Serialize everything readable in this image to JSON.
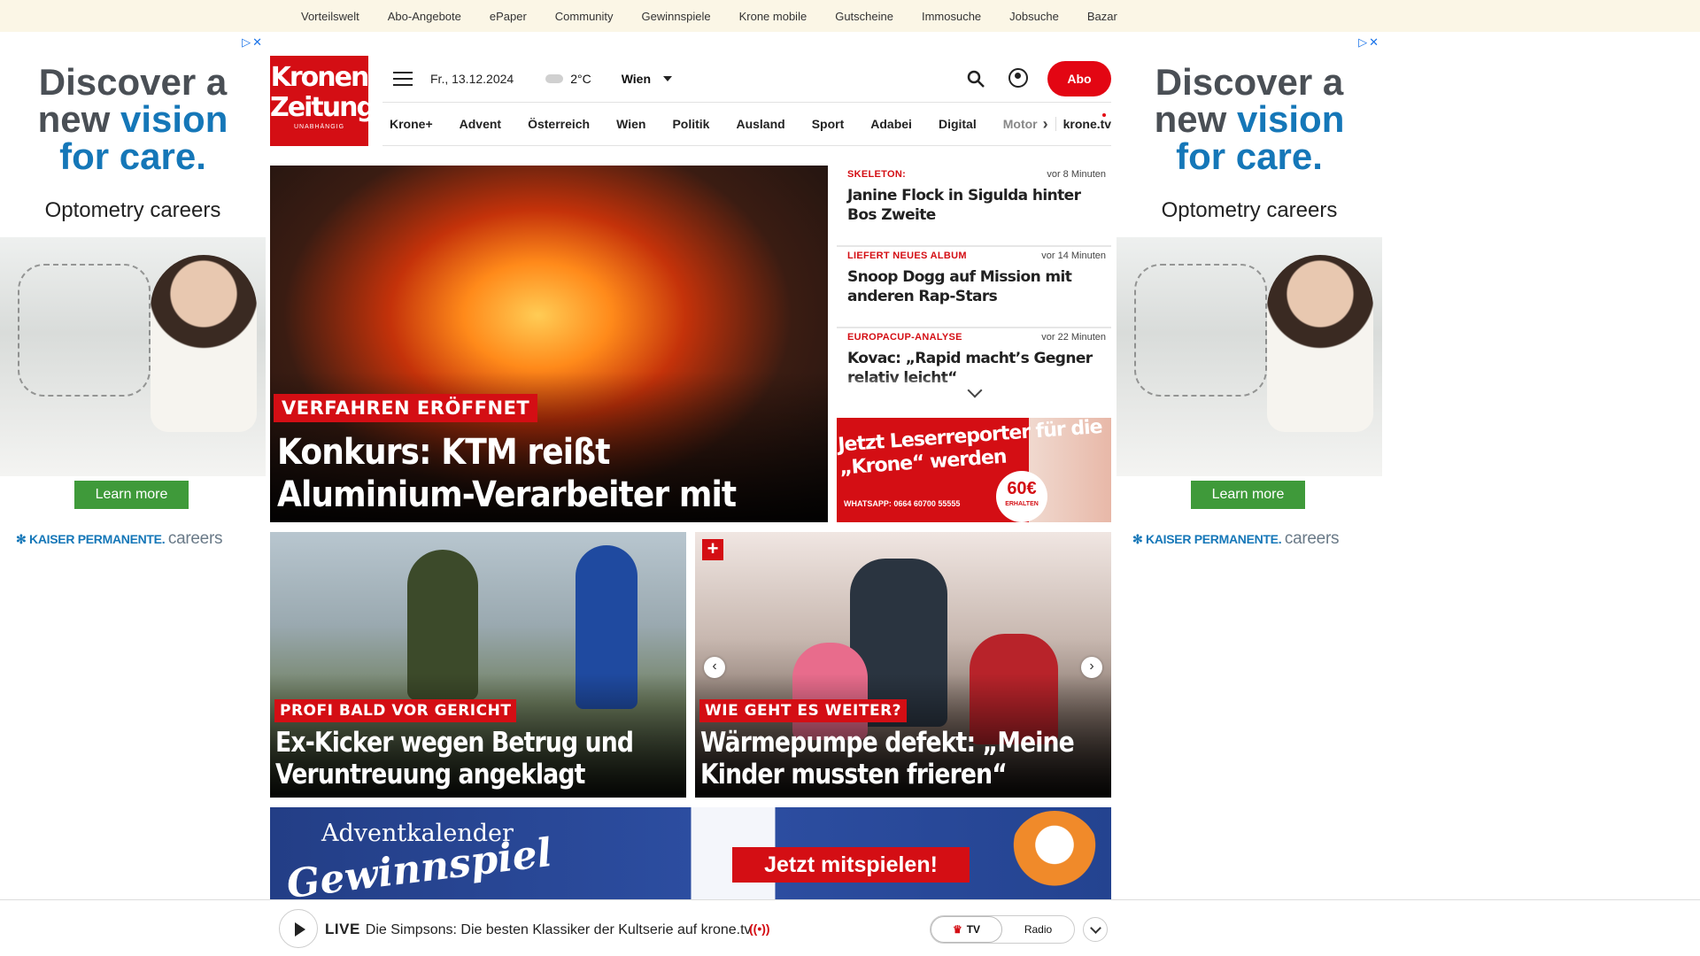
{
  "topnav": [
    "Vorteilswelt",
    "Abo-Angebote",
    "ePaper",
    "Community",
    "Gewinnspiele",
    "Krone mobile",
    "Gutscheine",
    "Immosuche",
    "Jobsuche",
    "Bazar"
  ],
  "ad": {
    "line1": "Discover a",
    "line2a": "new ",
    "line2b": "vision",
    "line3": "for care.",
    "sub": "Optometry careers",
    "cta": "Learn more",
    "brand": "KAISER PERMANENTE.",
    "brand_suffix": "careers"
  },
  "logo": {
    "line1": "Kronen",
    "line2": "Zeitung",
    "tag": "UNABHÄNGIG"
  },
  "header": {
    "date": "Fr., 13.12.2024",
    "temp": "2°C",
    "city": "Wien",
    "abo": "Abo"
  },
  "nav": [
    "Krone+",
    "Advent",
    "Österreich",
    "Wien",
    "Politik",
    "Ausland",
    "Sport",
    "Adabei",
    "Digital"
  ],
  "nav_fade": "Motor",
  "nav_tv": "krone.tv",
  "hero": {
    "kicker": "VERFAHREN ERÖFFNET",
    "title": "Konkurs: KTM reißt Aluminium-Verarbeiter mit"
  },
  "ticker": [
    {
      "kicker": "SKELETON:",
      "time": "vor 8 Minuten",
      "title": "Janine Flock in Sigulda hinter Bos Zweite"
    },
    {
      "kicker": "LIEFERT NEUES ALBUM",
      "time": "vor 14 Minuten",
      "title": "Snoop Dogg auf Mission mit anderen Rap-Stars"
    },
    {
      "kicker": "EUROPACUP-ANALYSE",
      "time": "vor 22 Minuten",
      "title": "Kovac: „Rapid macht’s Gegner relativ leicht“"
    }
  ],
  "reporter": {
    "title": "Jetzt Leserreporter für die „Krone“ werden",
    "whatsapp": "WHATSAPP: 0664 60700 55555",
    "amount": "60€",
    "amount_label": "ERHALTEN"
  },
  "card1": {
    "kicker": "PROFI BALD VOR GERICHT",
    "title": "Ex-Kicker wegen Betrug und Veruntreuung angeklagt"
  },
  "card2": {
    "kicker": "WIE GEHT ES WEITER?",
    "title": "Wärmepumpe defekt: „Meine Kinder mussten frieren“"
  },
  "advent": {
    "line1": "Adventkalender",
    "line2": "Gewinnspiel",
    "cta": "Jetzt mitspielen!"
  },
  "player": {
    "live": "LIVE",
    "text": "Die Simpsons: Die besten Klassiker der Kultserie auf krone.tv",
    "tv": "TV",
    "radio": "Radio"
  }
}
